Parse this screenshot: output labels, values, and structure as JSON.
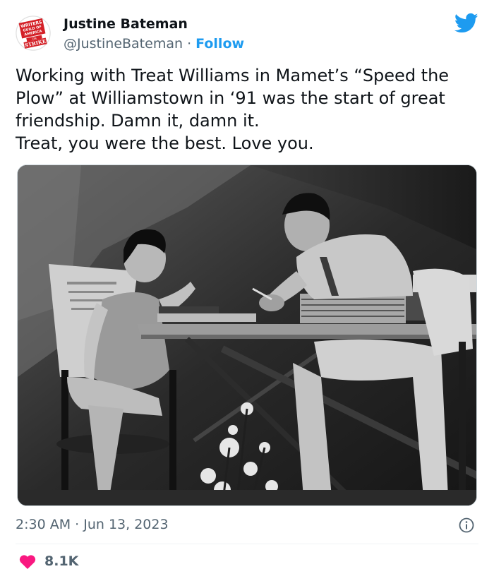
{
  "author": {
    "name": "Justine Bateman",
    "handle": "@JustineBateman",
    "separator": "·",
    "follow_label": "Follow",
    "avatar_badge_lines": [
      "WRITERS",
      "GUILD OF",
      "AMERICA",
      "ON",
      "STRIKE"
    ]
  },
  "tweet": {
    "text_lines": [
      "Working with Treat Williams in Mamet’s “Speed the",
      "Plow” at Williamstown in ‘91 was the start of great",
      "friendship. Damn it, damn it.",
      "Treat, you were the best. Love you."
    ],
    "timestamp": "2:30 AM · Jun 13, 2023",
    "likes": "8.1K"
  },
  "icons": {
    "platform": "twitter-bird-icon",
    "info": "info-icon",
    "like": "heart-icon"
  },
  "colors": {
    "accent": "#1d9bf0",
    "like": "#f91880",
    "text": "#0f1419",
    "muted": "#536471",
    "badge_red": "#d42027"
  }
}
